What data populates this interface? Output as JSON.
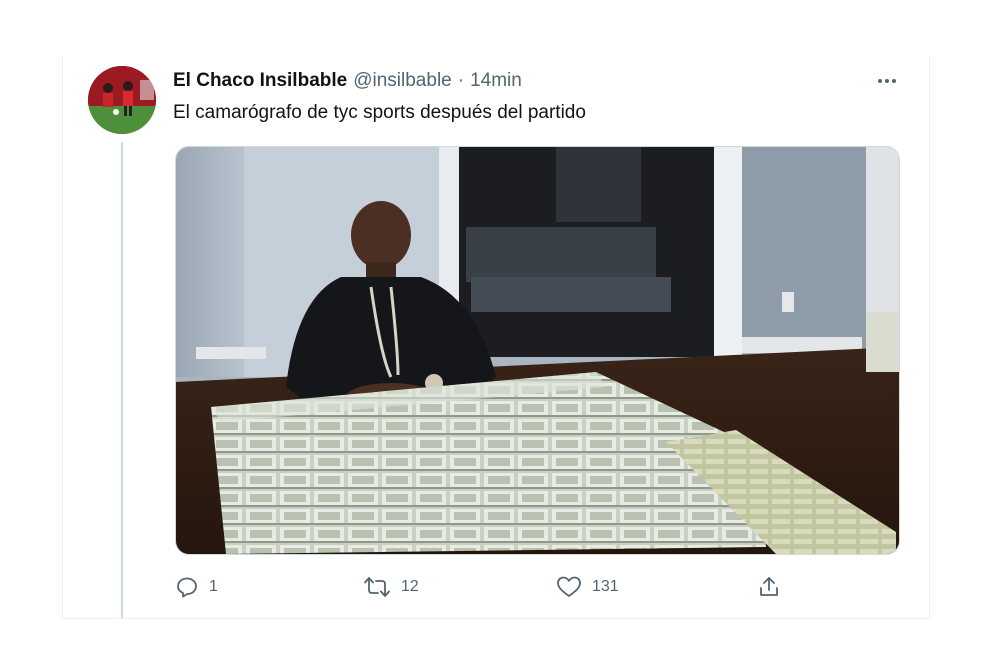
{
  "tweet": {
    "author_name": "El Chaco Insilbable",
    "handle": "@insilbable",
    "separator": "·",
    "time": "14min",
    "text": "El camarógrafo de tyc sports después del partido"
  },
  "actions": {
    "reply_count": "1",
    "retweet_count": "12",
    "like_count": "131"
  },
  "icons": {
    "reply": "comment-icon",
    "retweet": "retweet-icon",
    "like": "heart-icon",
    "share": "share-icon",
    "more": "more-dots-icon"
  },
  "colors": {
    "text_primary": "#0f1419",
    "text_secondary": "#536471",
    "thread_line": "#c7d9e6",
    "border": "#cfd9de"
  }
}
